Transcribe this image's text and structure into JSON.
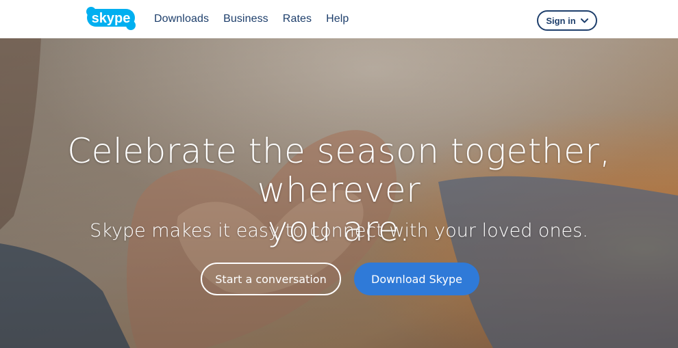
{
  "header": {
    "logo_text": "skype",
    "nav": [
      "Downloads",
      "Business",
      "Rates",
      "Help"
    ],
    "signin_label": "Sign in",
    "signin_icon": "chevron-down-icon"
  },
  "hero": {
    "headline_line1": "Celebrate the season together, wherever",
    "headline_line2": "you are.",
    "subtitle": "Skype makes it easy to connect with your loved ones.",
    "cta_secondary": "Start a conversation",
    "cta_primary": "Download Skype",
    "image_subject": "hands forming a heart shape against a sunset sky"
  },
  "colors": {
    "brand_blue": "#00aff0",
    "nav_text": "#1d3e6b",
    "cta_blue": "#2f7ad8",
    "hero_text": "#ffffff"
  }
}
